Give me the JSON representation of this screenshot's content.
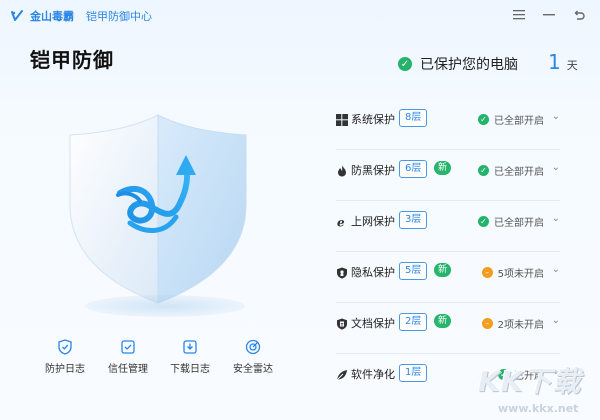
{
  "titlebar": {
    "app_name": "金山毒霸",
    "module": "铠甲防御中心",
    "buttons": [
      "menu-icon",
      "minimize-icon",
      "back-icon"
    ]
  },
  "header": {
    "title": "铠甲防御",
    "status_text": "已保护您的电脑",
    "days_value": "1",
    "days_unit": "天"
  },
  "tools": [
    {
      "label": "防护日志",
      "icon": "shield-log-icon"
    },
    {
      "label": "信任管理",
      "icon": "trust-icon"
    },
    {
      "label": "下载日志",
      "icon": "download-log-icon"
    },
    {
      "label": "安全雷达",
      "icon": "radar-icon"
    }
  ],
  "protections": [
    {
      "name": "系统保护",
      "layers": "8层",
      "new": "",
      "status": "已全部开启",
      "status_type": "ok",
      "icon": "windows-icon"
    },
    {
      "name": "防黑保护",
      "layers": "6层",
      "new": "新",
      "status": "已全部开启",
      "status_type": "ok",
      "icon": "flame-icon"
    },
    {
      "name": "上网保护",
      "layers": "3层",
      "new": "",
      "status": "已全部开启",
      "status_type": "ok",
      "icon": "browser-icon"
    },
    {
      "name": "隐私保护",
      "layers": "5层",
      "new": "新",
      "status": "5项未开启",
      "status_type": "warn",
      "icon": "privacy-shield-icon"
    },
    {
      "name": "文档保护",
      "layers": "2层",
      "new": "新",
      "status": "2项未开启",
      "status_type": "warn",
      "icon": "document-shield-icon"
    },
    {
      "name": "软件净化",
      "layers": "1层",
      "new": "",
      "status": "已开启",
      "status_type": "ok",
      "icon": "clean-leaf-icon"
    }
  ],
  "colors": {
    "accent": "#2b86e6",
    "ok": "#25b36a",
    "warn": "#f39c1f"
  },
  "watermark": {
    "logo": "KK下载",
    "url": "www.kkx.net"
  }
}
